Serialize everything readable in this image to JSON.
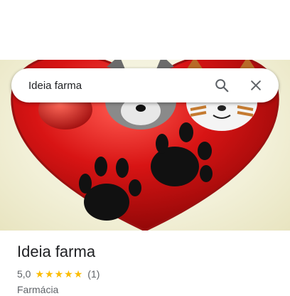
{
  "search": {
    "query": "Ideia farma",
    "search_icon": "search-icon",
    "close_icon": "close-icon"
  },
  "place": {
    "name": "Ideia farma",
    "rating": "5,0",
    "stars": 5,
    "review_count": "(1)",
    "category": "Farmácia"
  },
  "colors": {
    "star": "#fbbc04",
    "heart": "#d01818"
  }
}
